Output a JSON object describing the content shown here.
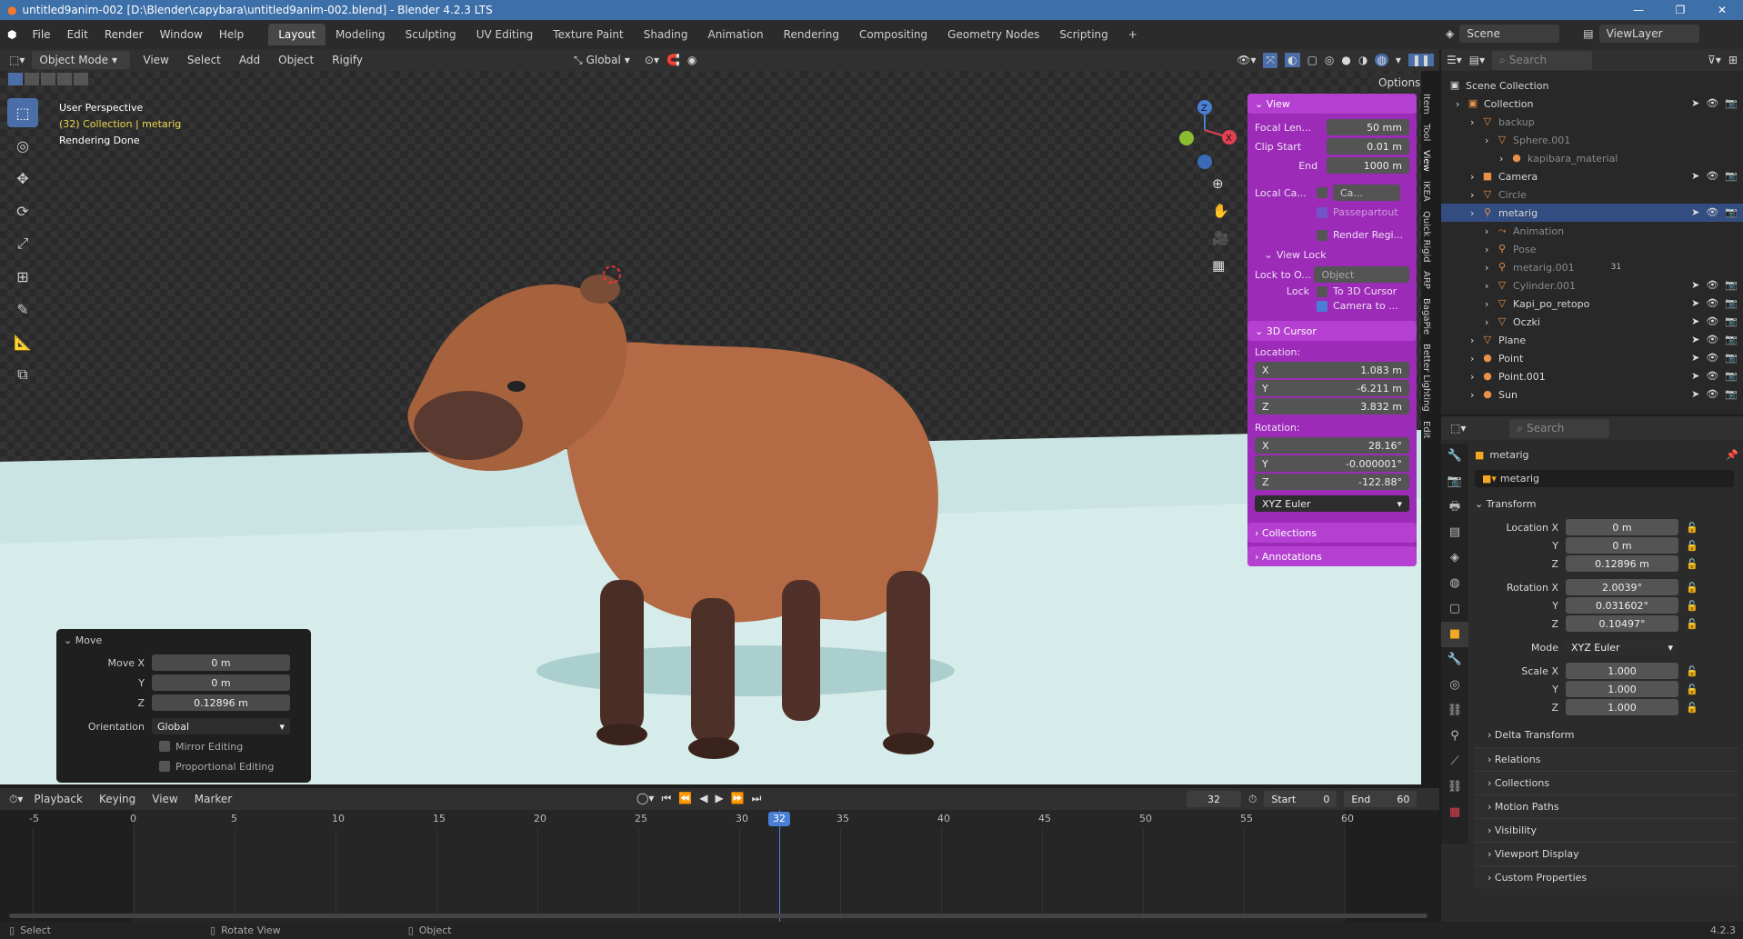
{
  "window": {
    "title": "untitled9anim-002 [D:\\Blender\\capybara\\untitled9anim-002.blend] - Blender 4.2.3 LTS",
    "minimize": "—",
    "maximize": "❐",
    "close": "✕"
  },
  "menu": {
    "items": [
      "File",
      "Edit",
      "Render",
      "Window",
      "Help"
    ],
    "workspaces": [
      "Layout",
      "Modeling",
      "Sculpting",
      "UV Editing",
      "Texture Paint",
      "Shading",
      "Animation",
      "Rendering",
      "Compositing",
      "Geometry Nodes",
      "Scripting"
    ],
    "active_workspace": "Layout",
    "add_tab": "+"
  },
  "scene": {
    "label": "Scene",
    "viewlayer": "ViewLayer"
  },
  "viewport_header": {
    "mode": "Object Mode",
    "menus": [
      "View",
      "Select",
      "Add",
      "Object",
      "Rigify"
    ],
    "transform_orientation": "Global",
    "options": "Options"
  },
  "overlay_text": {
    "perspective": "User Perspective",
    "collection": "(32) Collection | metarig",
    "status": "Rendering Done"
  },
  "gizmo": {
    "x": "X",
    "y": "Y",
    "z": "Z"
  },
  "npanel": {
    "view": {
      "header": "View",
      "focal_label": "Focal Len...",
      "focal": "50 mm",
      "clip_start_label": "Clip Start",
      "clip_start": "0.01 m",
      "end_label": "End",
      "end": "1000 m",
      "local_cam_label": "Local Ca...",
      "local_cam_value": "Ca...",
      "passepartout": "Passepartout",
      "render_region": "Render Regi..."
    },
    "view_lock": {
      "header": "View Lock",
      "lock_to_label": "Lock to O...",
      "lock_to_value": "Object",
      "lock_label": "Lock",
      "to_cursor": "To 3D Cursor",
      "camera_to": "Camera to ..."
    },
    "cursor": {
      "header": "3D Cursor",
      "location_label": "Location:",
      "loc_x": "1.083 m",
      "loc_y": "-6.211 m",
      "loc_z": "3.832 m",
      "rotation_label": "Rotation:",
      "rot_x": "28.16°",
      "rot_y": "-0.000001°",
      "rot_z": "-122.88°",
      "mode": "XYZ Euler"
    },
    "collections": "Collections",
    "annotations": "Annotations",
    "tabs": [
      "Item",
      "Tool",
      "View",
      "IKEA",
      "Quick Rigid",
      "ARP",
      "BagaPie",
      "Better Lighting",
      "Edit"
    ]
  },
  "move_panel": {
    "header": "Move",
    "move_x_label": "Move X",
    "move_x": "0 m",
    "y_label": "Y",
    "y": "0 m",
    "z_label": "Z",
    "z": "0.12896 m",
    "orientation_label": "Orientation",
    "orientation": "Global",
    "mirror": "Mirror Editing",
    "proportional": "Proportional Editing"
  },
  "outliner": {
    "search": "Search",
    "root": "Scene Collection",
    "rows": [
      {
        "name": "Collection",
        "indent": 1,
        "icon": "▣",
        "vis": true
      },
      {
        "name": "backup",
        "indent": 2,
        "icon": "▽",
        "dim": true
      },
      {
        "name": "Sphere.001",
        "indent": 3,
        "icon": "▽",
        "dim": true
      },
      {
        "name": "kapibara_material",
        "indent": 4,
        "icon": "●",
        "dim": true
      },
      {
        "name": "Camera",
        "indent": 2,
        "icon": "■",
        "vis": true
      },
      {
        "name": "Circle",
        "indent": 2,
        "icon": "▽",
        "dim": true
      },
      {
        "name": "metarig",
        "indent": 2,
        "icon": "⚲",
        "sel": true,
        "vis": true
      },
      {
        "name": "Animation",
        "indent": 3,
        "icon": "⤳",
        "dim": true
      },
      {
        "name": "Pose",
        "indent": 3,
        "icon": "⚲",
        "dim": true
      },
      {
        "name": "metarig.001",
        "indent": 3,
        "icon": "⚲",
        "dim": true,
        "badge": "31"
      },
      {
        "name": "Cylinder.001",
        "indent": 3,
        "icon": "▽",
        "dim": true,
        "vis": true
      },
      {
        "name": "Kapi_po_retopo",
        "indent": 3,
        "icon": "▽",
        "vis": true
      },
      {
        "name": "Oczki",
        "indent": 3,
        "icon": "▽",
        "vis": true
      },
      {
        "name": "Plane",
        "indent": 2,
        "icon": "▽",
        "vis": true
      },
      {
        "name": "Point",
        "indent": 2,
        "icon": "●",
        "vis": true
      },
      {
        "name": "Point.001",
        "indent": 2,
        "icon": "●",
        "vis": true
      },
      {
        "name": "Sun",
        "indent": 2,
        "icon": "●",
        "vis": true
      }
    ]
  },
  "properties": {
    "search": "Search",
    "object_name": "metarig",
    "datablock": "metarig",
    "transform": "Transform",
    "loc_x_label": "Location X",
    "loc_x": "0 m",
    "loc_y": "0 m",
    "loc_z": "0.12896 m",
    "rot_x_label": "Rotation X",
    "rot_x": "2.0039°",
    "rot_y": "0.031602°",
    "rot_z": "0.10497°",
    "mode_label": "Mode",
    "mode": "XYZ Euler",
    "scale_x_label": "Scale X",
    "scale_x": "1.000",
    "scale_y": "1.000",
    "scale_z": "1.000",
    "y_label": "Y",
    "z_label": "Z",
    "delta": "Delta Transform",
    "sections": [
      "Relations",
      "Collections",
      "Motion Paths",
      "Visibility",
      "Viewport Display",
      "Custom Properties"
    ]
  },
  "timeline": {
    "menus": [
      "Playback",
      "Keying",
      "View",
      "Marker"
    ],
    "current_frame": "32",
    "start_label": "Start",
    "start": "0",
    "end_label": "End",
    "end": "60",
    "ticks": [
      "-5",
      "0",
      "5",
      "10",
      "15",
      "20",
      "25",
      "30",
      "35",
      "40",
      "45",
      "50",
      "55",
      "60"
    ]
  },
  "statusbar": {
    "select": "Select",
    "rotate": "Rotate View",
    "object": "Object",
    "version": "4.2.3"
  }
}
